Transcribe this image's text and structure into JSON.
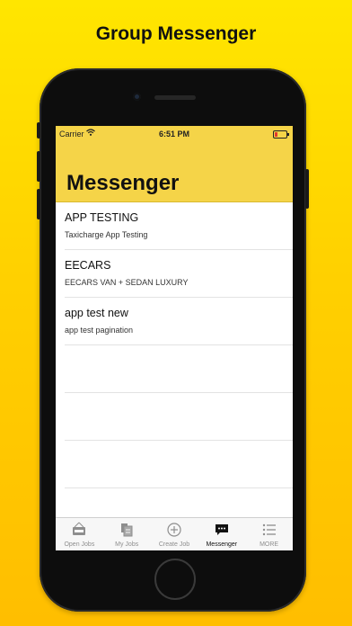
{
  "headline": "Group Messenger",
  "status": {
    "carrier": "Carrier",
    "time": "6:51 PM"
  },
  "nav": {
    "title": "Messenger"
  },
  "conversations": [
    {
      "title": "APP TESTING",
      "subtitle": "Taxicharge App Testing"
    },
    {
      "title": "EECARS",
      "subtitle": "EECARS VAN + SEDAN LUXURY"
    },
    {
      "title": "app test new",
      "subtitle": "app test pagination"
    }
  ],
  "tabs": [
    {
      "label": "Open Jobs",
      "icon": "open-sign-icon"
    },
    {
      "label": "My Jobs",
      "icon": "jobs-icon"
    },
    {
      "label": "Create Job",
      "icon": "plus-circle-icon"
    },
    {
      "label": "Messenger",
      "icon": "chat-bubble-icon",
      "active": true
    },
    {
      "label": "MORE",
      "icon": "list-icon"
    }
  ],
  "colors": {
    "accent": "#f5d448",
    "background": "#ffd000"
  }
}
